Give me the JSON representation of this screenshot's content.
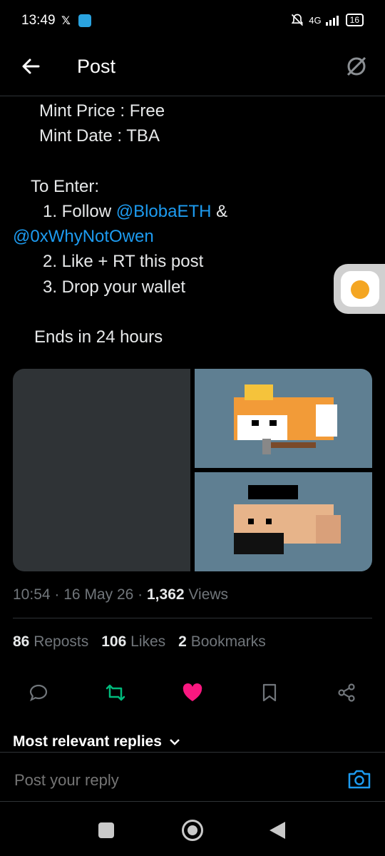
{
  "status_bar": {
    "time": "13:49",
    "network": "4G",
    "battery": "16"
  },
  "header": {
    "title": "Post"
  },
  "post": {
    "lines": [
      "Mint Price : Free",
      "Mint Date : TBA",
      "To Enter:",
      "1. Follow ",
      "@BlobaETH",
      " &",
      "@0xWhyNotOwen",
      "2. Like + RT this post",
      "3. Drop your wallet",
      "Ends in 24 hours"
    ]
  },
  "meta": {
    "time": "10:54",
    "date": "16 May 26",
    "views_count": "1,362",
    "views_label": "Views",
    "sep": "·"
  },
  "stats": {
    "reposts_count": "86",
    "reposts_label": "Reposts",
    "likes_count": "106",
    "likes_label": "Likes",
    "bookmarks_count": "2",
    "bookmarks_label": "Bookmarks"
  },
  "replies": {
    "sort_label": "Most relevant replies",
    "placeholder": "Post your reply"
  },
  "colors": {
    "accent": "#1d9bf0",
    "repost": "#00ba7c",
    "like": "#f91880"
  }
}
